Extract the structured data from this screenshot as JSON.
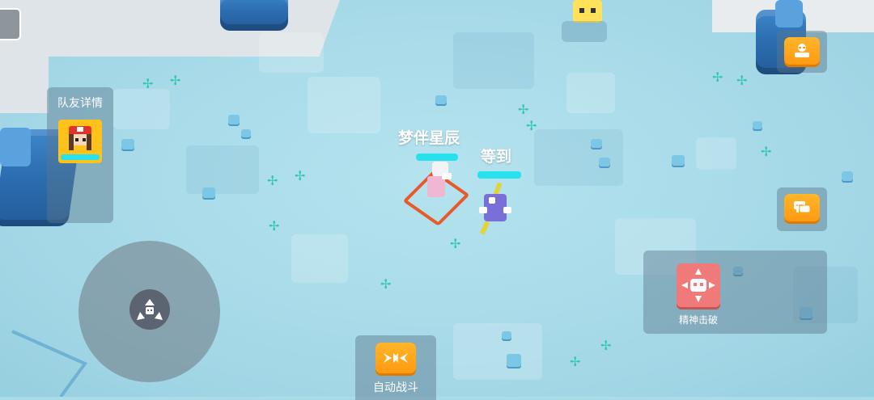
{
  "teammate_panel": {
    "title": "队友详情"
  },
  "player_pokemon": {
    "name": "梦伴星辰",
    "hp_fraction": 1.0
  },
  "ally_pokemon": {
    "name": "等到",
    "hp_fraction": 1.0
  },
  "buttons": {
    "auto_battle": "自动战斗",
    "skill": "精神击破"
  },
  "colors": {
    "accent_orange": "#ff9a10",
    "hp_cyan": "#27e1ef",
    "skill_red": "#f07a7a",
    "target_ring": "#e85a2a"
  },
  "icons": {
    "menu": "menu-icon",
    "chat": "chat-icon",
    "auto": "auto-battle-icon",
    "joystick": "joystick-arrows-icon",
    "skill": "psychic-skill-icon"
  }
}
